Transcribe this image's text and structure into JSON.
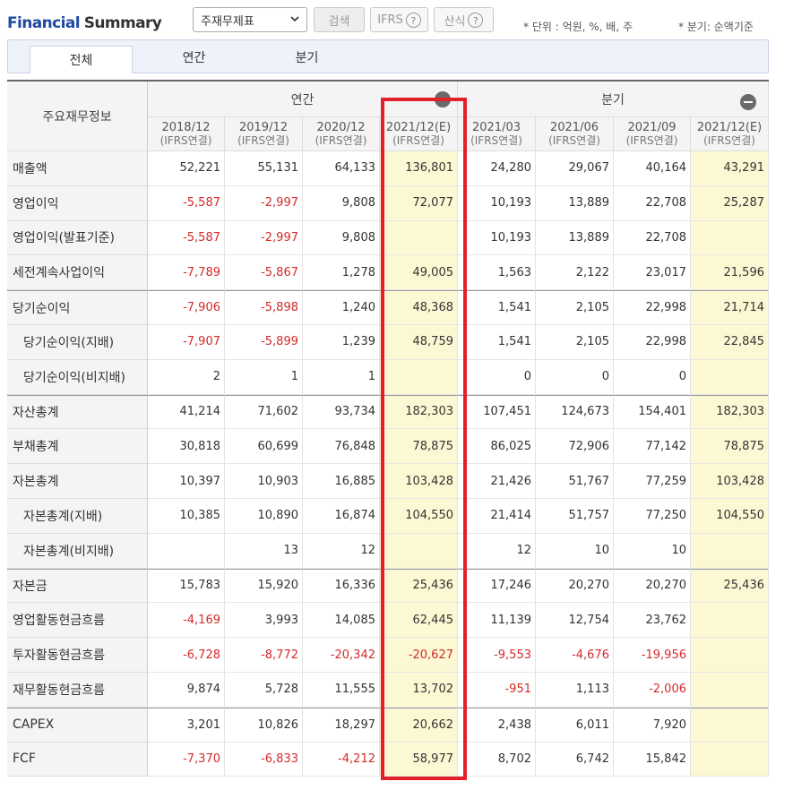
{
  "header": {
    "title_part1": "Financial",
    "title_part2": "Summary",
    "statement_select": "주재무제표",
    "search_label": "검색",
    "ifrs_label": "IFRS",
    "formula_label": "산식",
    "help_glyph": "?",
    "unit_note": "* 단위 : 억원, %, 배, 주",
    "quarter_note": "* 분기: 순액기준"
  },
  "tabs": [
    {
      "label": "전체"
    },
    {
      "label": "연간"
    },
    {
      "label": "분기"
    }
  ],
  "table": {
    "corner_label": "주요재무정보",
    "group_annual": "연간",
    "group_quarter": "분기",
    "columns": [
      {
        "period": "2018/12",
        "basis": "(IFRS연결)"
      },
      {
        "period": "2019/12",
        "basis": "(IFRS연결)"
      },
      {
        "period": "2020/12",
        "basis": "(IFRS연결)"
      },
      {
        "period": "2021/12(E)",
        "basis": "(IFRS연결)"
      },
      {
        "period": "2021/03",
        "basis": "(IFRS연결)"
      },
      {
        "period": "2021/06",
        "basis": "(IFRS연결)"
      },
      {
        "period": "2021/09",
        "basis": "(IFRS연결)"
      },
      {
        "period": "2021/12(E)",
        "basis": "(IFRS연결)"
      }
    ],
    "rows": [
      {
        "label": "매출액",
        "indent": false,
        "values": [
          "52,221",
          "55,131",
          "64,133",
          "136,801",
          "24,280",
          "29,067",
          "40,164",
          "43,291"
        ]
      },
      {
        "label": "영업이익",
        "indent": false,
        "values": [
          "-5,587",
          "-2,997",
          "9,808",
          "72,077",
          "10,193",
          "13,889",
          "22,708",
          "25,287"
        ]
      },
      {
        "label": "영업이익(발표기준)",
        "indent": false,
        "values": [
          "-5,587",
          "-2,997",
          "9,808",
          "",
          "10,193",
          "13,889",
          "22,708",
          ""
        ]
      },
      {
        "label": "세전계속사업이익",
        "indent": false,
        "values": [
          "-7,789",
          "-5,867",
          "1,278",
          "49,005",
          "1,563",
          "2,122",
          "23,017",
          "21,596"
        ]
      },
      {
        "label": "당기순이익",
        "indent": false,
        "values": [
          "-7,906",
          "-5,898",
          "1,240",
          "48,368",
          "1,541",
          "2,105",
          "22,998",
          "21,714"
        ]
      },
      {
        "label": "당기순이익(지배)",
        "indent": true,
        "values": [
          "-7,907",
          "-5,899",
          "1,239",
          "48,759",
          "1,541",
          "2,105",
          "22,998",
          "22,845"
        ]
      },
      {
        "label": "당기순이익(비지배)",
        "indent": true,
        "values": [
          "2",
          "1",
          "1",
          "",
          "0",
          "0",
          "0",
          ""
        ]
      },
      {
        "label": "자산총계",
        "indent": false,
        "values": [
          "41,214",
          "71,602",
          "93,734",
          "182,303",
          "107,451",
          "124,673",
          "154,401",
          "182,303"
        ]
      },
      {
        "label": "부채총계",
        "indent": false,
        "values": [
          "30,818",
          "60,699",
          "76,848",
          "78,875",
          "86,025",
          "72,906",
          "77,142",
          "78,875"
        ]
      },
      {
        "label": "자본총계",
        "indent": false,
        "values": [
          "10,397",
          "10,903",
          "16,885",
          "103,428",
          "21,426",
          "51,767",
          "77,259",
          "103,428"
        ]
      },
      {
        "label": "자본총계(지배)",
        "indent": true,
        "values": [
          "10,385",
          "10,890",
          "16,874",
          "104,550",
          "21,414",
          "51,757",
          "77,250",
          "104,550"
        ]
      },
      {
        "label": "자본총계(비지배)",
        "indent": true,
        "values": [
          "",
          "13",
          "12",
          "",
          "12",
          "10",
          "10",
          ""
        ]
      },
      {
        "label": "자본금",
        "indent": false,
        "values": [
          "15,783",
          "15,920",
          "16,336",
          "25,436",
          "17,246",
          "20,270",
          "20,270",
          "25,436"
        ]
      },
      {
        "label": "영업활동현금흐름",
        "indent": false,
        "values": [
          "-4,169",
          "3,993",
          "14,085",
          "62,445",
          "11,139",
          "12,754",
          "23,762",
          ""
        ]
      },
      {
        "label": "투자활동현금흐름",
        "indent": false,
        "values": [
          "-6,728",
          "-8,772",
          "-20,342",
          "-20,627",
          "-9,553",
          "-4,676",
          "-19,956",
          ""
        ]
      },
      {
        "label": "재무활동현금흐름",
        "indent": false,
        "values": [
          "9,874",
          "5,728",
          "11,555",
          "13,702",
          "-951",
          "1,113",
          "-2,006",
          ""
        ]
      },
      {
        "label": "CAPEX",
        "indent": false,
        "values": [
          "3,201",
          "10,826",
          "18,297",
          "20,662",
          "2,438",
          "6,011",
          "7,920",
          ""
        ]
      },
      {
        "label": "FCF",
        "indent": false,
        "values": [
          "-7,370",
          "-6,833",
          "-4,212",
          "58,977",
          "8,702",
          "6,742",
          "15,842",
          ""
        ]
      }
    ]
  },
  "colors": {
    "brand_blue": "#1f4aa3",
    "negative_red": "#d42a2a",
    "estimate_bg": "#fdf8d4",
    "highlight_box": "#e3202a"
  }
}
